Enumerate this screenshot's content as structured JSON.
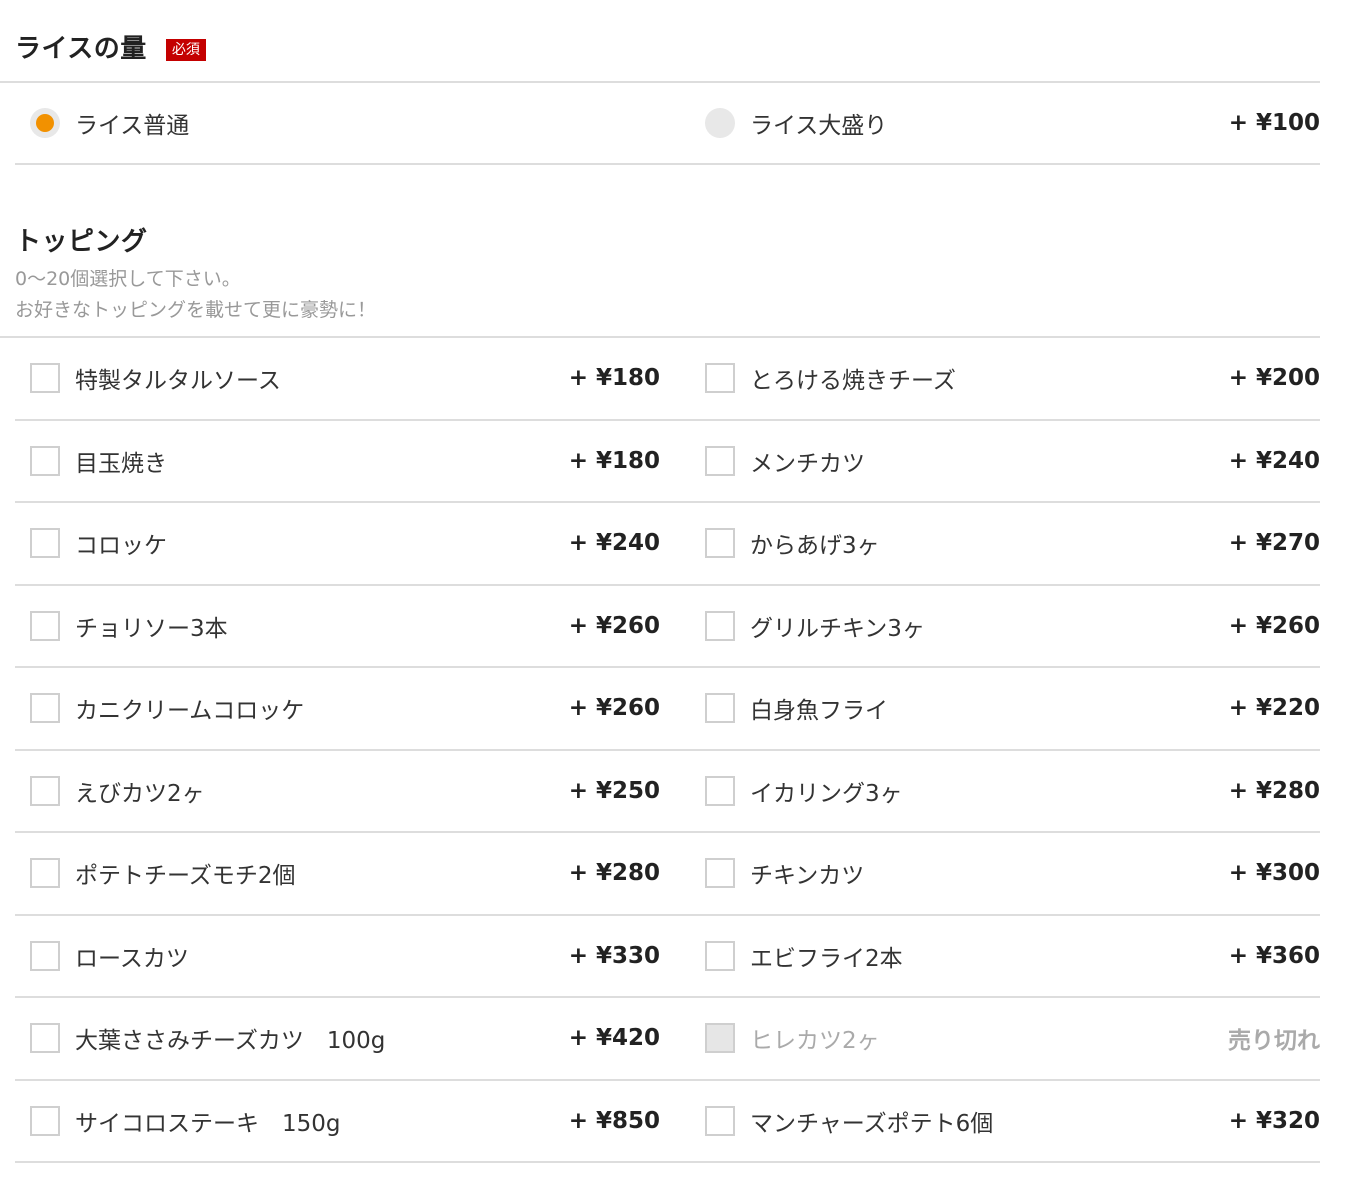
{
  "rice": {
    "title": "ライスの量",
    "required_badge": "必須",
    "options": [
      {
        "label": "ライス普通",
        "price": "",
        "selected": true
      },
      {
        "label": "ライス大盛り",
        "price": "+ ¥100",
        "selected": false
      }
    ]
  },
  "topping": {
    "title": "トッピング",
    "desc_line1": "0～20個選択して下さい。",
    "desc_line2": "お好きなトッピングを載せて更に豪勢に！",
    "rows": [
      [
        {
          "label": "特製タルタルソース",
          "price": "+ ¥180"
        },
        {
          "label": "とろける焼きチーズ",
          "price": "+ ¥200"
        }
      ],
      [
        {
          "label": "目玉焼き",
          "price": "+ ¥180"
        },
        {
          "label": "メンチカツ",
          "price": "+ ¥240"
        }
      ],
      [
        {
          "label": "コロッケ",
          "price": "+ ¥240"
        },
        {
          "label": "からあげ3ヶ",
          "price": "+ ¥270"
        }
      ],
      [
        {
          "label": "チョリソー3本",
          "price": "+ ¥260"
        },
        {
          "label": "グリルチキン3ヶ",
          "price": "+ ¥260"
        }
      ],
      [
        {
          "label": "カニクリームコロッケ",
          "price": "+ ¥260"
        },
        {
          "label": "白身魚フライ",
          "price": "+ ¥220"
        }
      ],
      [
        {
          "label": "えびカツ2ヶ",
          "price": "+ ¥250"
        },
        {
          "label": "イカリング3ヶ",
          "price": "+ ¥280"
        }
      ],
      [
        {
          "label": "ポテトチーズモチ2個",
          "price": "+ ¥280"
        },
        {
          "label": "チキンカツ",
          "price": "+ ¥300"
        }
      ],
      [
        {
          "label": "ロースカツ",
          "price": "+ ¥330"
        },
        {
          "label": "エビフライ2本",
          "price": "+ ¥360"
        }
      ],
      [
        {
          "label": "大葉ささみチーズカツ　100g",
          "price": "+ ¥420"
        },
        {
          "label": "ヒレカツ2ヶ",
          "price": "売り切れ",
          "sold_out": true
        }
      ],
      [
        {
          "label": "サイコロステーキ　150g",
          "price": "+ ¥850"
        },
        {
          "label": "マンチャーズポテト6個",
          "price": "+ ¥320"
        }
      ]
    ]
  },
  "colors": {
    "accent": "#f29100",
    "required_badge_bg": "#c40000",
    "divider": "#dddddd",
    "muted_text": "#999999"
  }
}
